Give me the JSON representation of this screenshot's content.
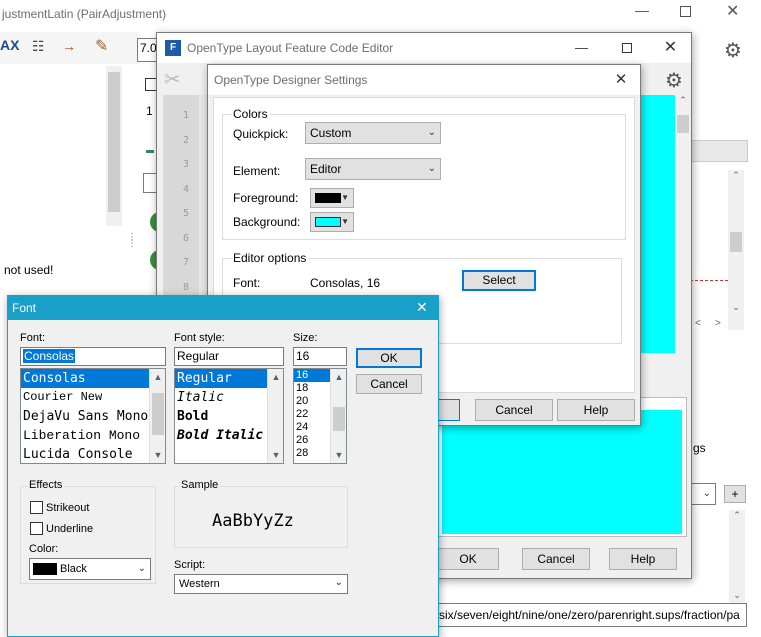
{
  "bg_window": {
    "title": "justmentLatin (PairAdjustment)",
    "toolbar_value": "7.0",
    "line_number": "1",
    "side_text": "not used!",
    "right_text": "gs",
    "plus_label": "+",
    "path_text": "six/seven/eight/nine/one/zero/parenright.sups/fraction/pa"
  },
  "feature_editor": {
    "title": "OpenType Layout Feature Code Editor",
    "line_numbers": [
      "1",
      "2",
      "3",
      "4",
      "5",
      "6",
      "7",
      "8"
    ],
    "ok_label": "OK",
    "cancel_label": "Cancel",
    "help_label": "Help",
    "editor_bg": "#00ffff"
  },
  "designer_settings": {
    "title": "OpenType Designer Settings",
    "colors_group": "Colors",
    "quickpick_label": "Quickpick:",
    "quickpick_value": "Custom",
    "element_label": "Element:",
    "element_value": "Editor",
    "foreground_label": "Foreground:",
    "foreground_color": "#000000",
    "background_label": "Background:",
    "background_color": "#00ffff",
    "editor_options_group": "Editor options",
    "font_label": "Font:",
    "font_value": "Consolas, 16",
    "select_label": "Select",
    "cancel_label": "Cancel",
    "help_label": "Help"
  },
  "font_dialog": {
    "title": "Font",
    "font_label": "Font:",
    "font_value": "Consolas",
    "fonts": [
      "Consolas",
      "Courier New",
      "DejaVu Sans Mono",
      "Liberation Mono",
      "Lucida Console"
    ],
    "style_label": "Font style:",
    "style_value": "Regular",
    "styles": [
      "Regular",
      "Italic",
      "Bold",
      "Bold Italic"
    ],
    "size_label": "Size:",
    "size_value": "16",
    "sizes": [
      "16",
      "18",
      "20",
      "22",
      "24",
      "26",
      "28"
    ],
    "ok_label": "OK",
    "cancel_label": "Cancel",
    "effects_label": "Effects",
    "strikeout_label": "Strikeout",
    "underline_label": "Underline",
    "color_label": "Color:",
    "color_value": "Black",
    "sample_label": "Sample",
    "sample_text": "AaBbYyZz",
    "script_label": "Script:",
    "script_value": "Western",
    "accent_color": "#0078d7"
  }
}
